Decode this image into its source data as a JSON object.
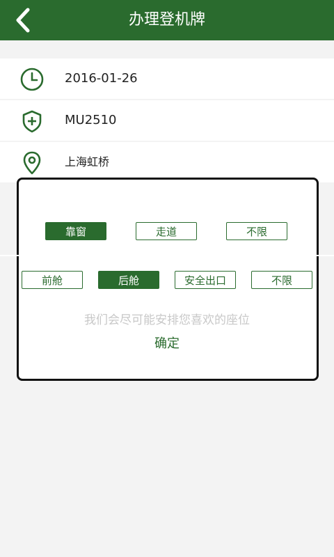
{
  "header": {
    "title": "办理登机牌"
  },
  "rows": [
    {
      "icon": "clock-icon",
      "value": "2016-01-26"
    },
    {
      "icon": "shield-plus-icon",
      "value": "MU2510"
    },
    {
      "icon": "location-pin-icon",
      "value": "上海虹桥"
    }
  ],
  "dialog": {
    "seat_position": {
      "options": [
        "靠窗",
        "走道",
        "不限"
      ],
      "selected": "靠窗"
    },
    "cabin": {
      "options": [
        "前舱",
        "后舱",
        "安全出口",
        "不限"
      ],
      "selected": "后舱"
    },
    "hint": "我们会尽可能安排您喜欢的座位",
    "confirm_label": "确定"
  },
  "colors": {
    "primary": "#2a6b2e",
    "background": "#f3f3f3",
    "hint": "#c8c8c8"
  }
}
